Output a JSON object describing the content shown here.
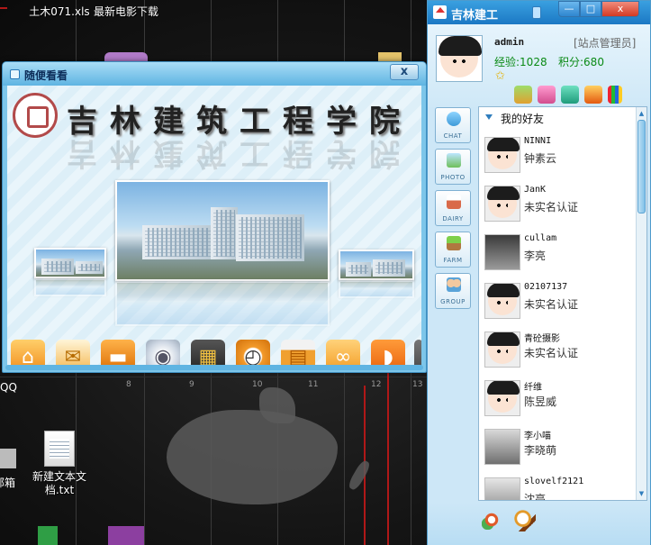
{
  "desktop": {
    "icons": [
      {
        "label": "土木071.xls"
      },
      {
        "label": "最新电影下载"
      },
      {
        "label": "新建文本文档.txt"
      }
    ],
    "partial_labels": [
      "QQ",
      "邮箱"
    ],
    "map_ticks": [
      "8",
      "9",
      "10",
      "11",
      "12",
      "13"
    ]
  },
  "slide_window": {
    "title": "随便看看",
    "close_label": "x",
    "school_name": "吉林建筑工程学院",
    "dock_icons": [
      "home-icon",
      "mail-icon",
      "briefcase-icon",
      "disc-icon",
      "clapper-icon",
      "clock-icon",
      "calendar-icon",
      "chain-icon",
      "rss-icon"
    ]
  },
  "qq": {
    "title": "吉林建工",
    "buttons": {
      "minimize": "—",
      "maximize": "□",
      "close": "x"
    },
    "user": {
      "name": "admin",
      "role": "[站点管理员]",
      "exp_label": "经验:1028",
      "points_label": "积分:680"
    },
    "side_tabs": [
      "CHAT",
      "PHOTO",
      "DAIRY",
      "FARM",
      "GROUP"
    ],
    "group_name": "我的好友",
    "friends": [
      {
        "nick": "NINNI",
        "name": "钟素云"
      },
      {
        "nick": "JanK",
        "name": "未实名认证"
      },
      {
        "nick": "cullam",
        "name": "李亮"
      },
      {
        "nick": "02107137",
        "name": "未实名认证"
      },
      {
        "nick": "青砼摄影",
        "name": "未实名认证"
      },
      {
        "nick": "纤维",
        "name": "陈昱威"
      },
      {
        "nick": "李小喵",
        "name": "李晓萌"
      },
      {
        "nick": "slovelf2121",
        "name": "沈亮"
      }
    ],
    "colors": {
      "accent": "#1b78c4",
      "panel": "#cde7f7",
      "window": "#7dc6ea"
    }
  }
}
